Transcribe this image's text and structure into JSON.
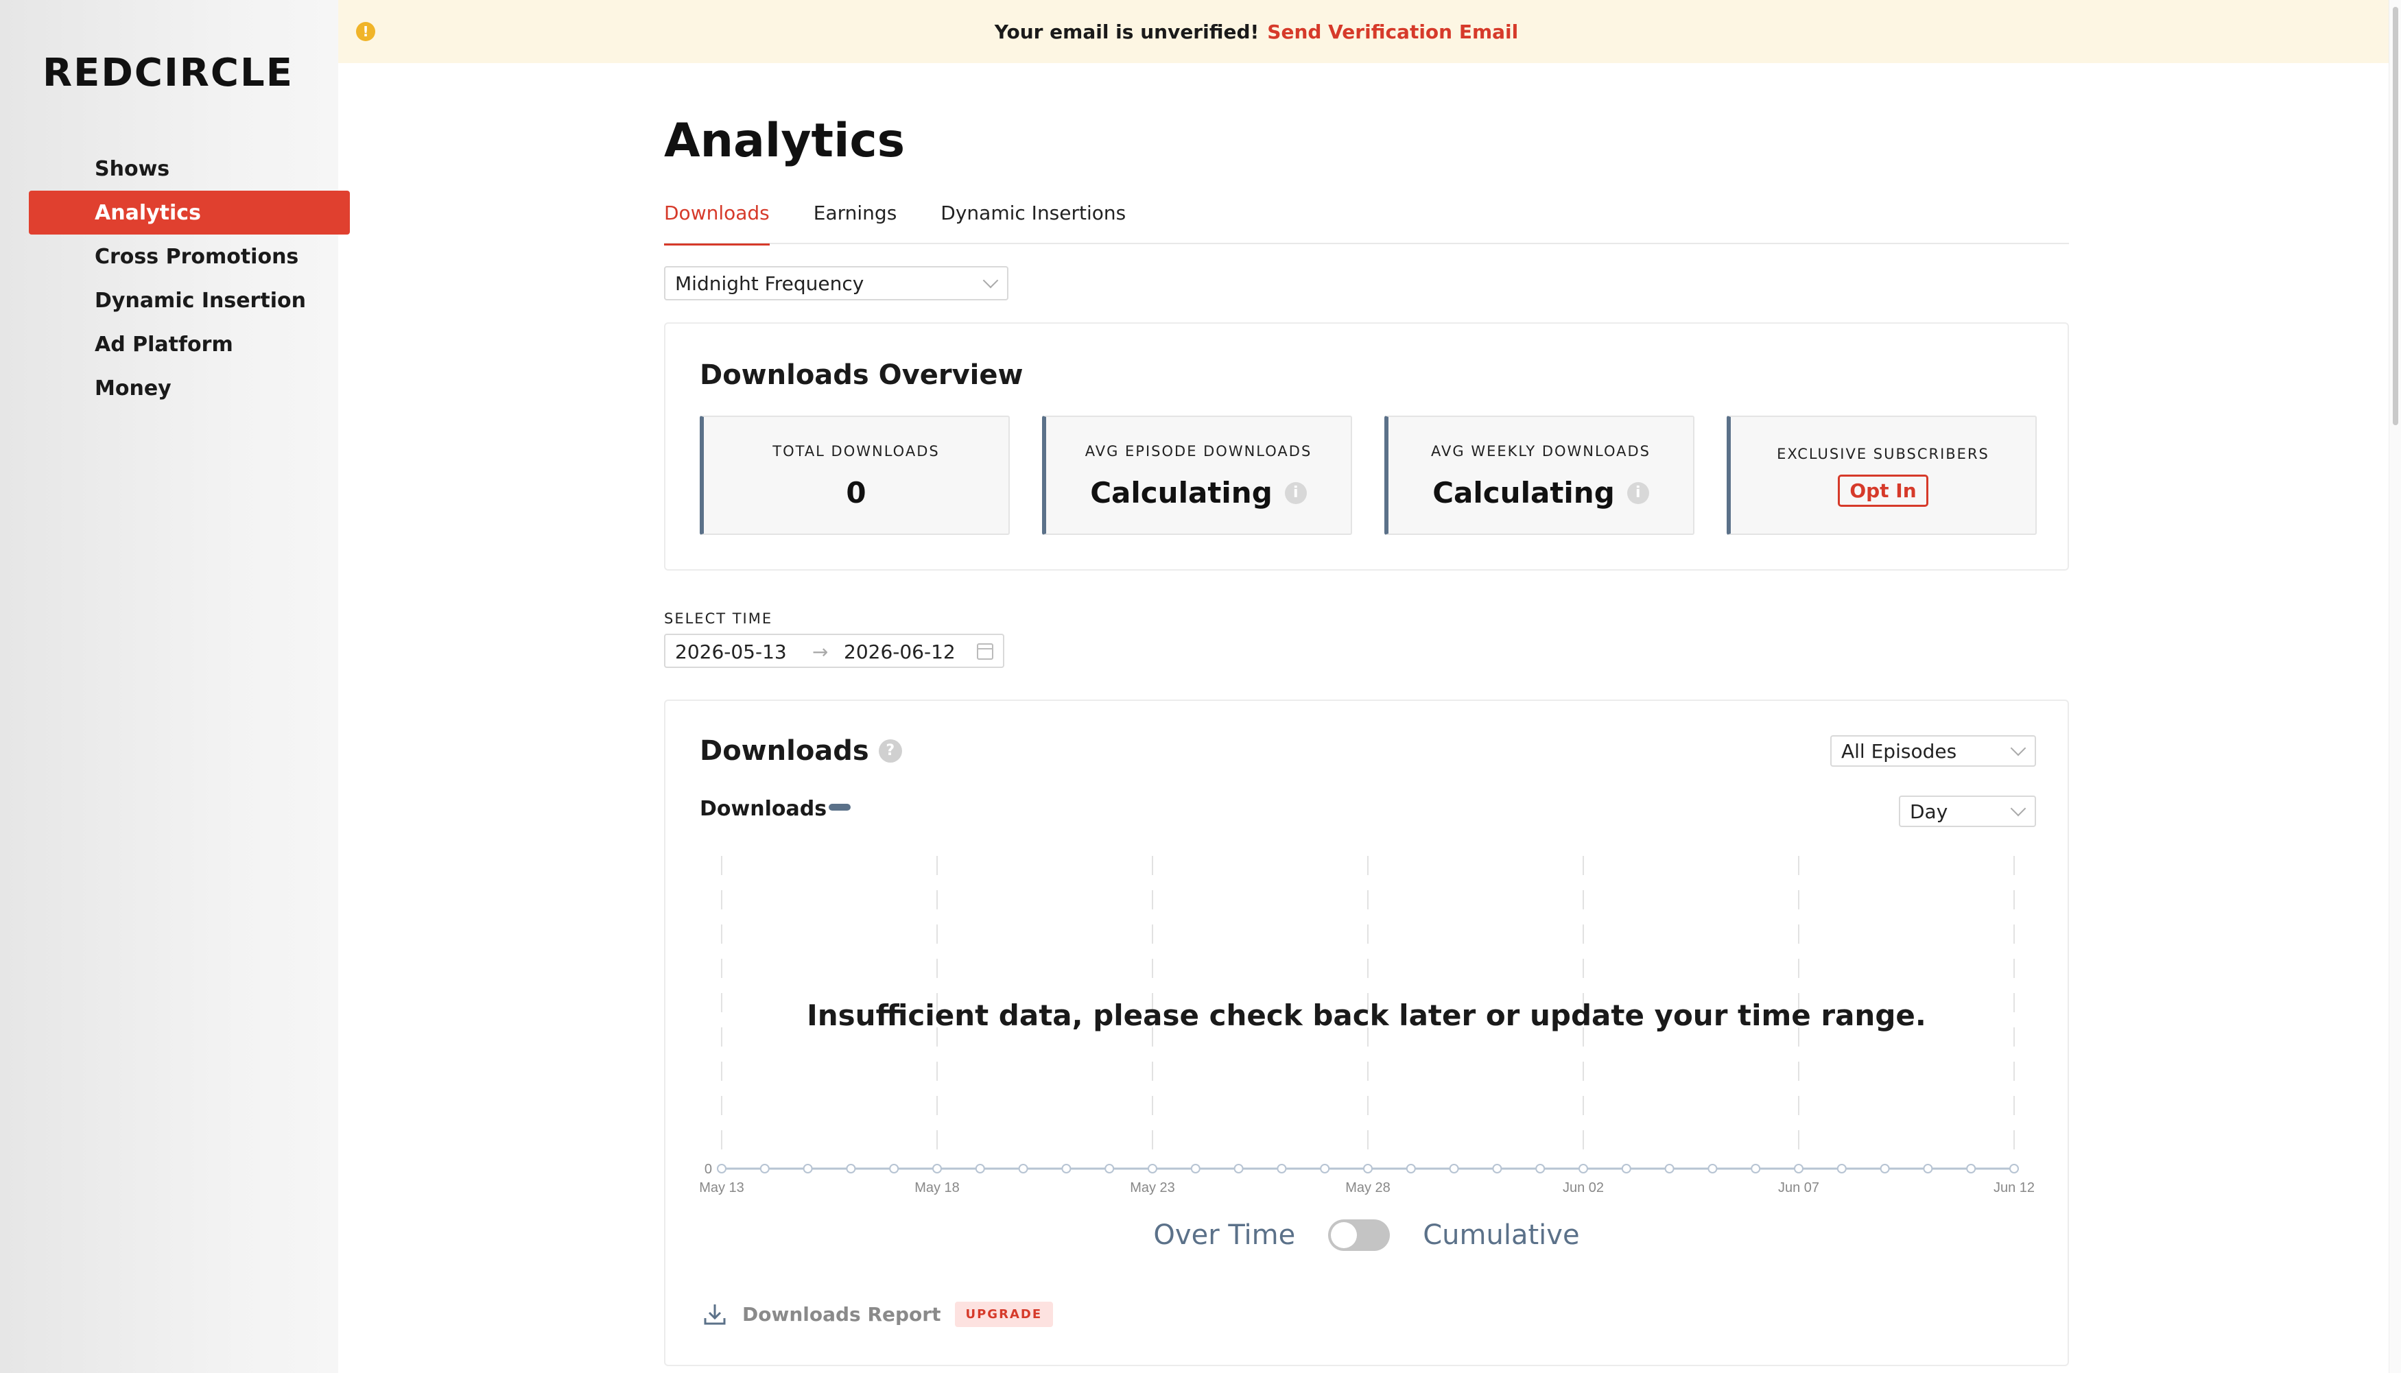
{
  "brand": {
    "logo_pre": "RED",
    "logo_o": "C",
    "logo_post": "IRCLE",
    "accent": "#e0402f"
  },
  "banner": {
    "message": "Your email is unverified!",
    "link": "Send Verification Email",
    "icon": "warning-icon"
  },
  "sidebar": {
    "items": [
      {
        "label": "Shows",
        "active": false
      },
      {
        "label": "Analytics",
        "active": true
      },
      {
        "label": "Cross Promotions",
        "active": false
      },
      {
        "label": "Dynamic Insertion",
        "active": false
      },
      {
        "label": "Ad Platform",
        "active": false
      },
      {
        "label": "Money",
        "active": false
      }
    ]
  },
  "main": {
    "title": "Analytics",
    "tabs": [
      {
        "label": "Downloads",
        "active": true
      },
      {
        "label": "Earnings",
        "active": false
      },
      {
        "label": "Dynamic Insertions",
        "active": false
      }
    ],
    "show_select": "Midnight Frequency"
  },
  "overview": {
    "title": "Downloads Overview",
    "stats": [
      {
        "label": "TOTAL DOWNLOADS",
        "value": "0",
        "info": false
      },
      {
        "label": "AVG EPISODE DOWNLOADS",
        "value": "Calculating",
        "info": true
      },
      {
        "label": "AVG WEEKLY DOWNLOADS",
        "value": "Calculating",
        "info": true
      },
      {
        "label": "EXCLUSIVE SUBSCRIBERS",
        "button": "Opt In"
      }
    ]
  },
  "time": {
    "label": "SELECT TIME",
    "start": "2026-05-13",
    "end": "2026-06-12"
  },
  "downloads": {
    "title": "Downloads",
    "episodes_select": "All Episodes",
    "interval_select": "Day",
    "legend": "Downloads",
    "no_data": "Insufficient data, please check back later or update your time range.",
    "toggle_left": "Over Time",
    "toggle_right": "Cumulative",
    "report_label": "Downloads Report",
    "upgrade": "UPGRADE"
  },
  "chart_data": {
    "type": "line",
    "x": [
      "May 13",
      "May 14",
      "May 15",
      "May 16",
      "May 17",
      "May 18",
      "May 19",
      "May 20",
      "May 21",
      "May 22",
      "May 23",
      "May 24",
      "May 25",
      "May 26",
      "May 27",
      "May 28",
      "May 29",
      "May 30",
      "May 31",
      "Jun 01",
      "Jun 02",
      "Jun 03",
      "Jun 04",
      "Jun 05",
      "Jun 06",
      "Jun 07",
      "Jun 08",
      "Jun 09",
      "Jun 10",
      "Jun 11",
      "Jun 12"
    ],
    "tick_labels": [
      "May 13",
      "May 18",
      "May 23",
      "May 28",
      "Jun 02",
      "Jun 07",
      "Jun 12"
    ],
    "series": [
      {
        "name": "Downloads",
        "values": [
          0,
          0,
          0,
          0,
          0,
          0,
          0,
          0,
          0,
          0,
          0,
          0,
          0,
          0,
          0,
          0,
          0,
          0,
          0,
          0,
          0,
          0,
          0,
          0,
          0,
          0,
          0,
          0,
          0,
          0,
          0
        ]
      }
    ],
    "y_tick_labels": [
      "0"
    ],
    "grid": "vertical-dashed",
    "color": "#5b7189"
  }
}
